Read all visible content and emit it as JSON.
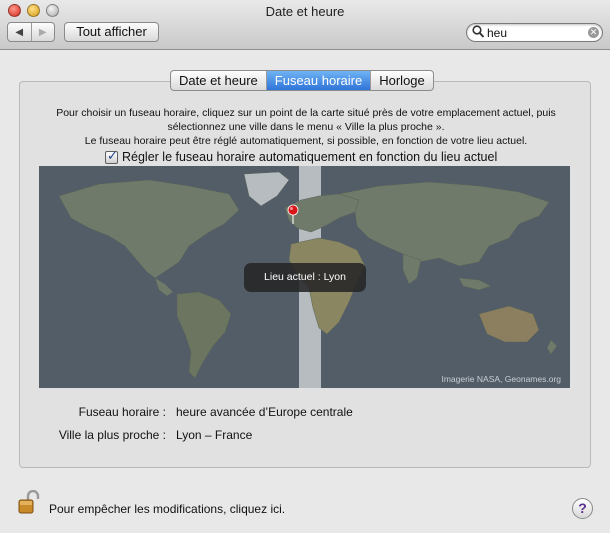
{
  "window": {
    "title": "Date et heure"
  },
  "toolbar": {
    "back_label": "◀",
    "forward_label": "▶",
    "show_all_label": "Tout afficher"
  },
  "search": {
    "value": "heu"
  },
  "tabs": [
    {
      "label": "Date et heure",
      "selected": false
    },
    {
      "label": "Fuseau horaire",
      "selected": true
    },
    {
      "label": "Horloge",
      "selected": false
    }
  ],
  "intro": {
    "line1": "Pour choisir un fuseau horaire, cliquez sur un point de la carte situé près de votre emplacement actuel, puis",
    "line2": "sélectionnez une ville dans le menu « Ville la plus proche ».",
    "line3": "Le fuseau horaire peut être réglé automatiquement, si possible, en fonction de votre lieu actuel."
  },
  "auto_timezone": {
    "label": "Régler le fuseau horaire automatiquement en fonction du lieu actuel",
    "checked": true
  },
  "map": {
    "tooltip": "Lieu actuel : Lyon",
    "credit": "Imagerie NASA, Geonames.org"
  },
  "details": {
    "timezone_label": "Fuseau horaire :",
    "timezone_value": "heure avancée d’Europe centrale",
    "city_label": "Ville la plus proche :",
    "city_value": "Lyon – France"
  },
  "footer": {
    "lock_text": "Pour empêcher les modifications, cliquez ici.",
    "help_label": "?"
  },
  "colors": {
    "accent": "#2f74d9",
    "pin": "#d8161b",
    "ocean": "#525d68"
  },
  "icons": {
    "lock": "lock-icon",
    "search": "search-icon",
    "clear": "clear-icon",
    "help": "help-icon",
    "pin": "location-pin-icon"
  }
}
